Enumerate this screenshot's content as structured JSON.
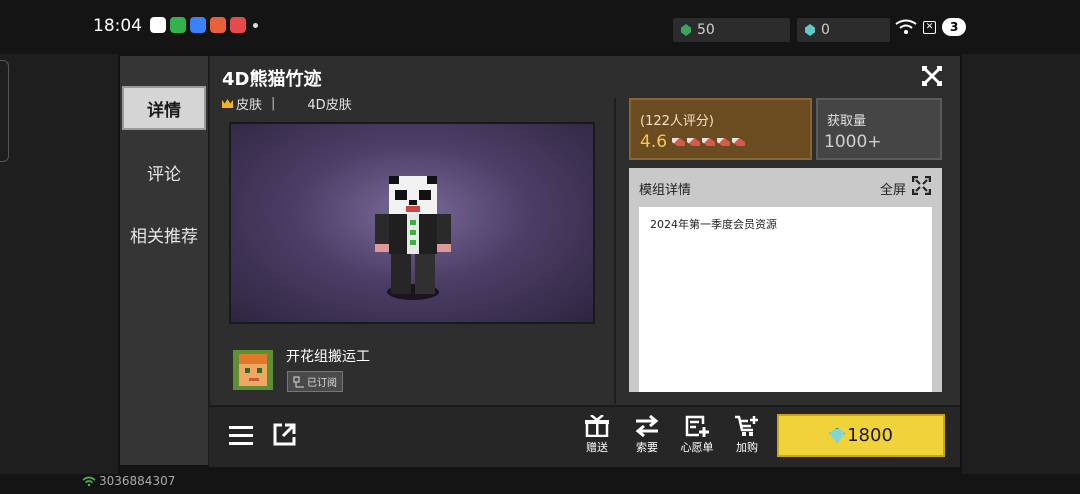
{
  "status_bar": {
    "time": "18:04"
  },
  "currencies": [
    {
      "label": "emerald-icon",
      "value": "50",
      "color": "#3aa65a"
    },
    {
      "label": "diamond-icon",
      "value": "0",
      "color": "#5fc9c9"
    }
  ],
  "net": {
    "badge": "3"
  },
  "sidebar": {
    "items": [
      {
        "label": "详情"
      },
      {
        "label": "评论"
      },
      {
        "label": "相关推荐"
      }
    ]
  },
  "item": {
    "title": "4D熊猫竹迹",
    "category": "皮肤",
    "type": "4D皮肤"
  },
  "author": {
    "name": "开花组搬运工",
    "subscribed": "已订阅"
  },
  "rating": {
    "count": "(122人评分)",
    "score": "4.6",
    "stars": 5
  },
  "downloads": {
    "label": "获取量",
    "value": "1000+"
  },
  "details": {
    "header": "模组详情",
    "fullscreen": "全屏",
    "text": "2024年第一季度会员资源"
  },
  "actions": [
    {
      "label": "赠送"
    },
    {
      "label": "索要"
    },
    {
      "label": "心愿单"
    },
    {
      "label": "加购"
    }
  ],
  "buy": {
    "price": "1800"
  },
  "user": {
    "id": "3036884307"
  },
  "colors": {
    "accent": "#f0d23b",
    "rating_bg": "#6b4b20",
    "dialog_bg": "#2e2e2e"
  }
}
